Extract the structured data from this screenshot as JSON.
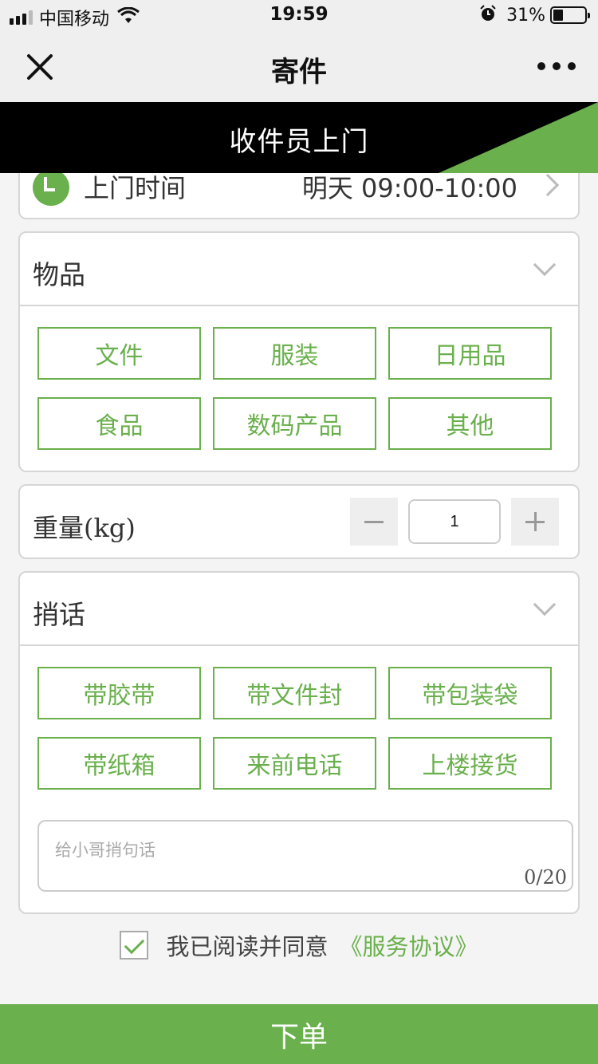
{
  "status_bar": {
    "carrier": "中国移动",
    "time": "19:59",
    "battery_percent": "31%",
    "battery_level": 0.31,
    "icons": [
      "signal-icon",
      "wifi-icon",
      "alarm-icon",
      "battery-icon"
    ]
  },
  "nav": {
    "title": "寄件",
    "icons": [
      "close-icon",
      "more-icon"
    ]
  },
  "banner": {
    "text": "收件员上门"
  },
  "pickup_time": {
    "label": "上门时间",
    "value": "明天 09:00-10:00",
    "icons": [
      "clock-icon",
      "chevron-right-icon"
    ]
  },
  "goods": {
    "title": "物品",
    "options": [
      "文件",
      "服装",
      "日用品",
      "食品",
      "数码产品",
      "其他"
    ]
  },
  "weight": {
    "label": "重量(kg)",
    "value": "1"
  },
  "message": {
    "title": "捎话",
    "options": [
      "带胶带",
      "带文件封",
      "带包装袋",
      "带纸箱",
      "来前电话",
      "上楼接货"
    ],
    "placeholder": "给小哥捎句话",
    "count": "0/20"
  },
  "agreement": {
    "checked": true,
    "text": "我已阅读并同意",
    "link": "《服务协议》"
  },
  "submit_label": "下单",
  "colors": {
    "accent": "#6ab04c",
    "banner": "#000000"
  }
}
